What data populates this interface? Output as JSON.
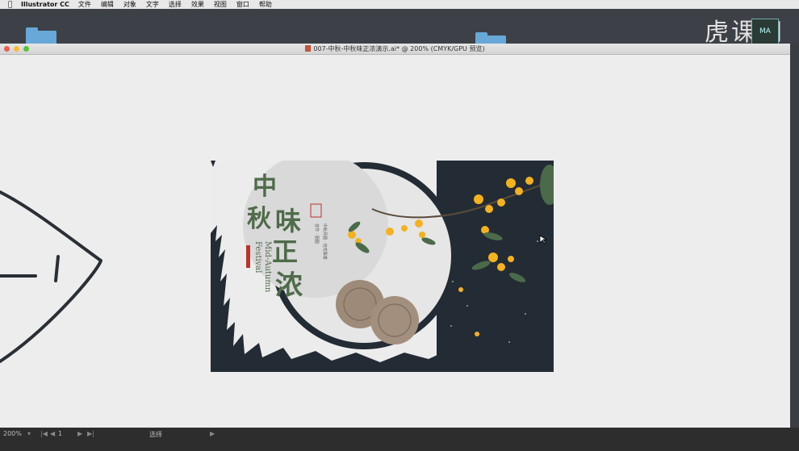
{
  "menubar": {
    "app_name": "Illustrator CC",
    "items": [
      "文件",
      "编辑",
      "对象",
      "文字",
      "选择",
      "效果",
      "视图",
      "窗口",
      "帮助"
    ]
  },
  "watermark": {
    "text": "虎课网"
  },
  "avatar": {
    "text": "MA"
  },
  "window": {
    "title": "007-中秋-中秋味正浓演示.ai* @ 200% (CMYK/GPU 预览)"
  },
  "artwork": {
    "title_chars": [
      "中",
      "秋",
      "味",
      "正",
      "浓"
    ],
    "subtitle_line1": "Mid-Autumn",
    "subtitle_line2": "Festival",
    "body_text_1": "中秋月圆 · 桂花飘香",
    "body_text_2": "佳节 · 团圆",
    "colors": {
      "background_dark": "#232b35",
      "moon": "#e6e6e6",
      "title_green": "#4f6b4a",
      "mooncake": "#9e8a79",
      "osmanthus": "#f3b21e",
      "leaf_green": "#4b6a4a",
      "seal_red": "#b8342c"
    }
  },
  "statusbar": {
    "zoom": "200%",
    "artboard_index": "1",
    "tool": "选择"
  }
}
